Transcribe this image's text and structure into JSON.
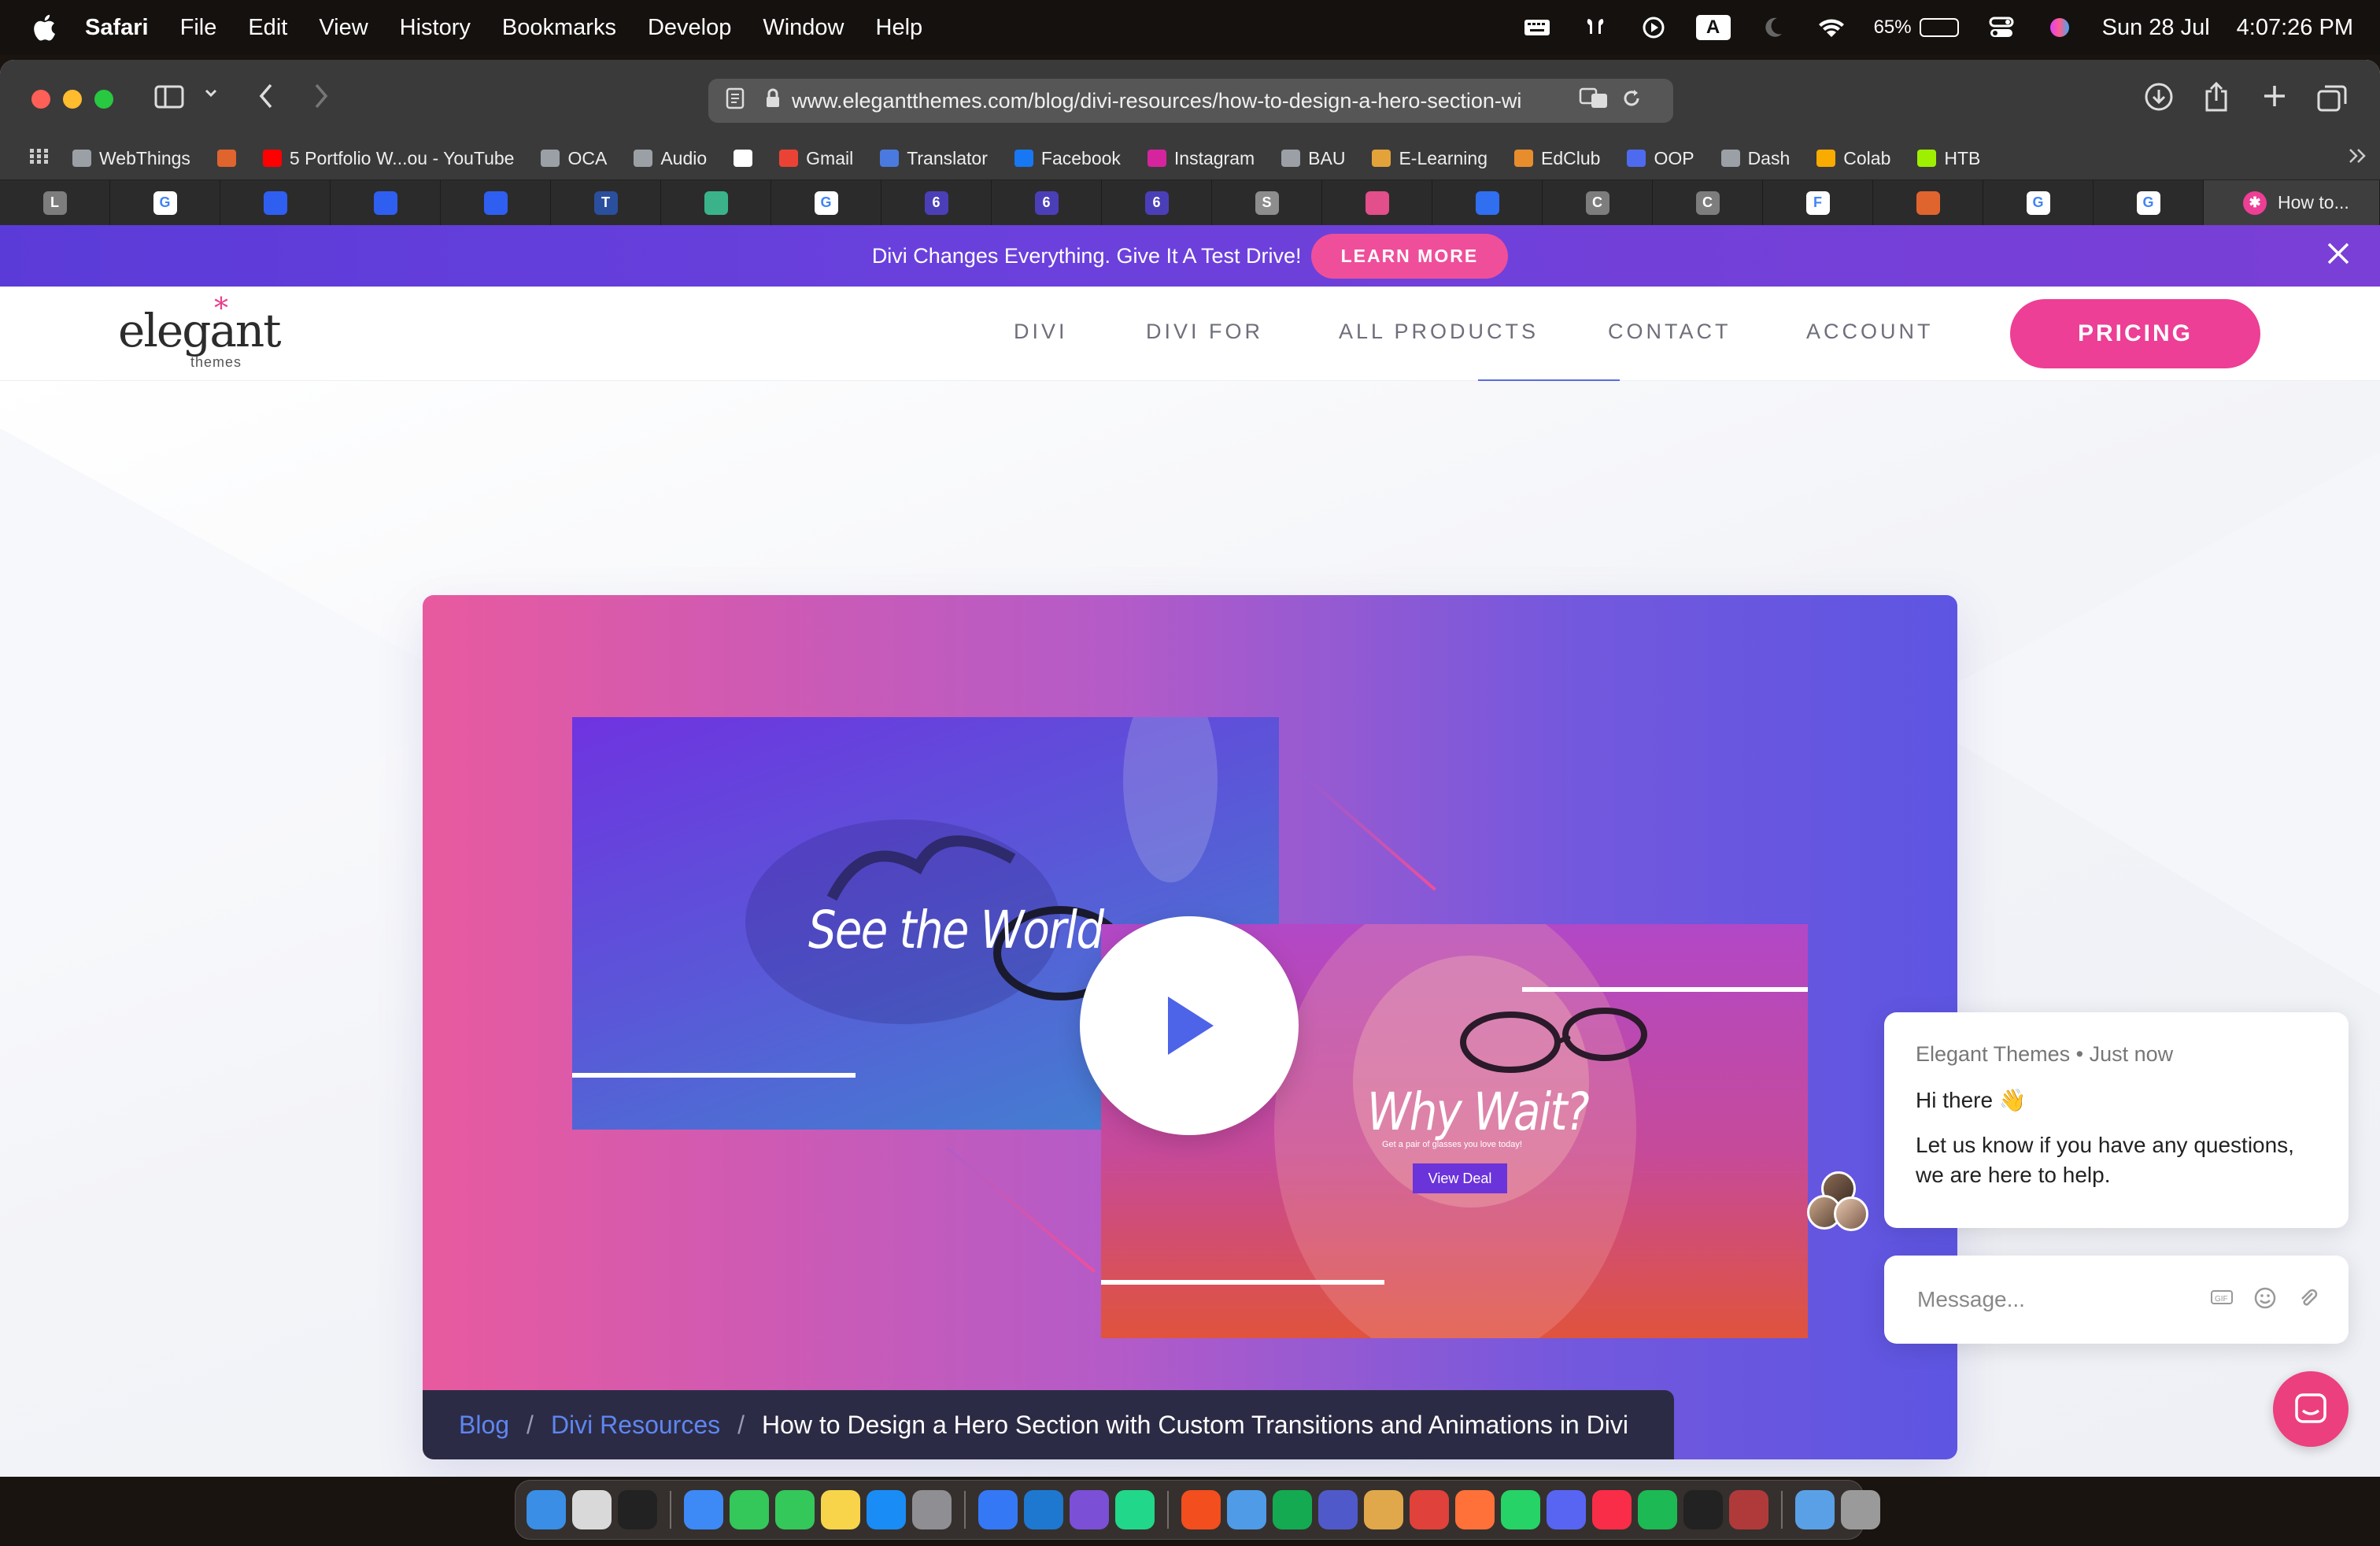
{
  "menubar": {
    "app": "Safari",
    "items": [
      "File",
      "Edit",
      "View",
      "History",
      "Bookmarks",
      "Develop",
      "Window",
      "Help"
    ],
    "input_letter": "A",
    "battery_percent": "65%",
    "battery_level": 0.65,
    "date": "Sun 28 Jul",
    "time": "4:07:26 PM"
  },
  "browser": {
    "url": "www.elegantthemes.com/blog/divi-resources/how-to-design-a-hero-section-wi",
    "bookmarks": [
      {
        "label": "WebThings",
        "color": "#9aa0a6"
      },
      {
        "label": "",
        "color": "#e0642e"
      },
      {
        "label": "5 Portfolio W...ou - YouTube",
        "color": "#ff0000"
      },
      {
        "label": "OCA",
        "color": "#9aa0a6"
      },
      {
        "label": "Audio",
        "color": "#9aa0a6"
      },
      {
        "label": "",
        "color": "#ffffff"
      },
      {
        "label": "Gmail",
        "color": "#ea4335"
      },
      {
        "label": "Translator",
        "color": "#4a7ae0"
      },
      {
        "label": "Facebook",
        "color": "#1877f2"
      },
      {
        "label": "Instagram",
        "color": "#d6249f"
      },
      {
        "label": "BAU",
        "color": "#9aa0a6"
      },
      {
        "label": "E-Learning",
        "color": "#e3a33a"
      },
      {
        "label": "EdClub",
        "color": "#e88d2e"
      },
      {
        "label": "OOP",
        "color": "#4e6bf0"
      },
      {
        "label": "Dash",
        "color": "#9aa0a6"
      },
      {
        "label": "Colab",
        "color": "#f9ab00"
      },
      {
        "label": "HTB",
        "color": "#9fef00"
      }
    ],
    "tabs": [
      {
        "glyph": "L",
        "color": "#7d7d7d"
      },
      {
        "glyph": "G",
        "color": "#ffffff"
      },
      {
        "glyph": "",
        "color": "#2f5ff0"
      },
      {
        "glyph": "",
        "color": "#2f5ff0"
      },
      {
        "glyph": "",
        "color": "#2f5ff0"
      },
      {
        "glyph": "T",
        "color": "#2a4f9c"
      },
      {
        "glyph": "",
        "color": "#3bb38a"
      },
      {
        "glyph": "G",
        "color": "#ffffff"
      },
      {
        "glyph": "6",
        "color": "#4b3fb8"
      },
      {
        "glyph": "6",
        "color": "#4b3fb8"
      },
      {
        "glyph": "6",
        "color": "#4b3fb8"
      },
      {
        "glyph": "S",
        "color": "#8d8d8d"
      },
      {
        "glyph": "",
        "color": "#e24f8a"
      },
      {
        "glyph": "",
        "color": "#2f6ff0"
      },
      {
        "glyph": "C",
        "color": "#7d7d7d"
      },
      {
        "glyph": "C",
        "color": "#7d7d7d"
      },
      {
        "glyph": "F",
        "color": "#ffffff"
      },
      {
        "glyph": "",
        "color": "#e0642e"
      },
      {
        "glyph": "G",
        "color": "#ffffff"
      },
      {
        "glyph": "G",
        "color": "#ffffff"
      }
    ],
    "active_tab": "How to..."
  },
  "promo": {
    "text": "Divi Changes Everything. Give It A Test Drive!",
    "button": "LEARN MORE"
  },
  "site": {
    "logo": "elegant",
    "logo_sub": "themes",
    "nav": [
      "DIVI",
      "DIVI FOR",
      "ALL PRODUCTS",
      "CONTACT",
      "ACCOUNT"
    ],
    "pricing": "PRICING"
  },
  "hero": {
    "card1_title": "See the World",
    "card2_title": "Why Wait?",
    "card2_tagline": "Get a pair of glasses you love today!",
    "card2_button": "View Deal"
  },
  "breadcrumb": {
    "blog": "Blog",
    "category": "Divi Resources",
    "current": "How to Design a Hero Section with Custom Transitions and Animations in Divi"
  },
  "chat": {
    "meta": "Elegant Themes • Just now",
    "greeting": "Hi there 👋",
    "message": "Let us know if you have any questions, we are here to help.",
    "placeholder": "Message..."
  },
  "dock": {
    "apps": [
      {
        "name": "finder",
        "color": "#3a8ee6"
      },
      {
        "name": "launchpad",
        "color": "#d9d9d9"
      },
      {
        "name": "terminal",
        "color": "#222222"
      },
      {
        "name": "sep"
      },
      {
        "name": "safari",
        "color": "#3d8af7"
      },
      {
        "name": "facetime",
        "color": "#34c759"
      },
      {
        "name": "messages",
        "color": "#34c759"
      },
      {
        "name": "notes",
        "color": "#f7d44a"
      },
      {
        "name": "app-store",
        "color": "#1a8cf5"
      },
      {
        "name": "system-settings",
        "color": "#8e8e93"
      },
      {
        "name": "sep"
      },
      {
        "name": "xcode",
        "color": "#3478f6"
      },
      {
        "name": "vscode",
        "color": "#1e78d0"
      },
      {
        "name": "visual-studio",
        "color": "#7b4fd6"
      },
      {
        "name": "pycharm",
        "color": "#21d789"
      },
      {
        "name": "sep"
      },
      {
        "name": "figma",
        "color": "#f24e1e"
      },
      {
        "name": "pages",
        "color": "#4f9be8"
      },
      {
        "name": "mongodb",
        "color": "#13aa52"
      },
      {
        "name": "teams",
        "color": "#5059c9"
      },
      {
        "name": "vlc",
        "color": "#e0a84a"
      },
      {
        "name": "chrome",
        "color": "#e0413a"
      },
      {
        "name": "firefox",
        "color": "#ff7139"
      },
      {
        "name": "whatsapp",
        "color": "#25d366"
      },
      {
        "name": "discord",
        "color": "#5865f2"
      },
      {
        "name": "music",
        "color": "#fa2d48"
      },
      {
        "name": "spotify",
        "color": "#1db954"
      },
      {
        "name": "iterm",
        "color": "#222222"
      },
      {
        "name": "dictionary",
        "color": "#b03a3a"
      },
      {
        "name": "sep"
      },
      {
        "name": "downloads",
        "color": "#5aa0e6"
      },
      {
        "name": "trash",
        "color": "#9a9a9a"
      }
    ]
  }
}
